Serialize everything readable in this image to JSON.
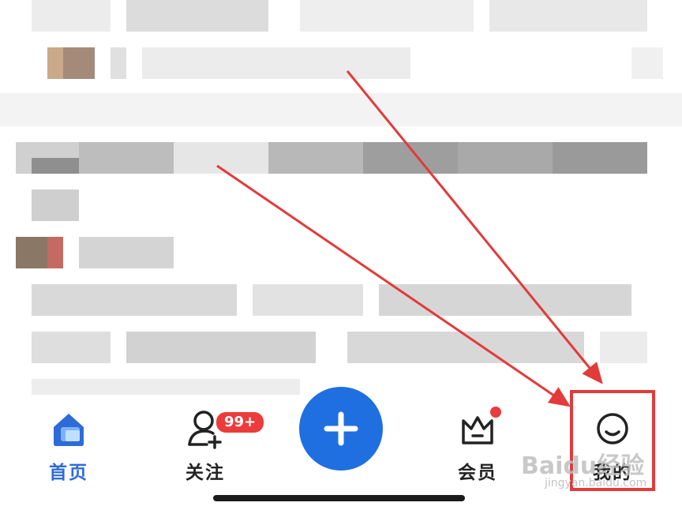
{
  "tabbar": {
    "tabs": [
      {
        "label": "首页",
        "icon": "home-icon",
        "active": true
      },
      {
        "label": "关注",
        "icon": "follow-icon",
        "active": false
      },
      {
        "label": "会员",
        "icon": "vip-crown-icon",
        "active": false
      },
      {
        "label": "我的",
        "icon": "profile-icon",
        "active": false
      }
    ],
    "follow_badge": "99+",
    "create_icon": "plus-icon"
  },
  "watermark": {
    "brand": "Baidu经验",
    "url": "jingyan.baidu.com"
  },
  "colors": {
    "accent": "#1f6fe0",
    "active_tab": "#2d6bd8",
    "badge": "#ec3b3b",
    "annotation": "#e33a3a"
  }
}
